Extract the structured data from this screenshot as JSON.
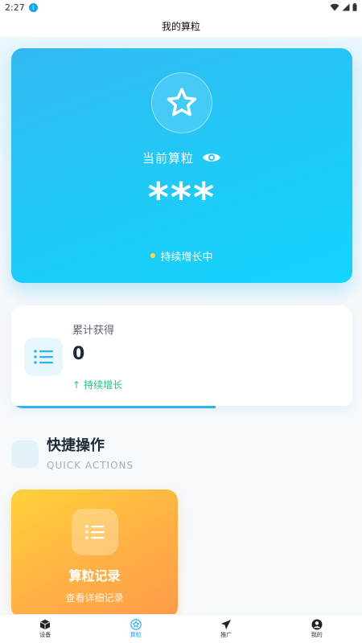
{
  "status_bar": {
    "time": "2:27",
    "notification_badge": "i"
  },
  "header": {
    "title": "我的算粒"
  },
  "hero": {
    "label": "当前算粒",
    "value": "***",
    "status": "持续增长中",
    "icon": "star-icon",
    "visibility_icon": "eye-icon"
  },
  "stats": {
    "label": "累计获得",
    "value": "0",
    "trend": "持续增长",
    "trend_arrow": "↑",
    "progress": 0.6,
    "icon": "list-icon"
  },
  "quick_actions": {
    "title": "快捷操作",
    "subtitle": "QUICK ACTIONS",
    "items": [
      {
        "title": "算粒记录",
        "description": "查看详细记录",
        "icon": "list-icon"
      }
    ]
  },
  "bottom_nav": {
    "items": [
      {
        "label": "设备",
        "icon": "cube-icon",
        "active": false
      },
      {
        "label": "算粒",
        "icon": "star-circle-icon",
        "active": true
      },
      {
        "label": "推广",
        "icon": "send-icon",
        "active": false
      },
      {
        "label": "我的",
        "icon": "user-icon",
        "active": false
      }
    ]
  },
  "colors": {
    "accent": "#1aa3e8",
    "hero_gradient_start": "#34b9f3",
    "hero_gradient_end": "#14d4ff",
    "trend_green": "#22c08a",
    "action_gradient_start": "#ffd23a",
    "action_gradient_end": "#ff9a49"
  }
}
